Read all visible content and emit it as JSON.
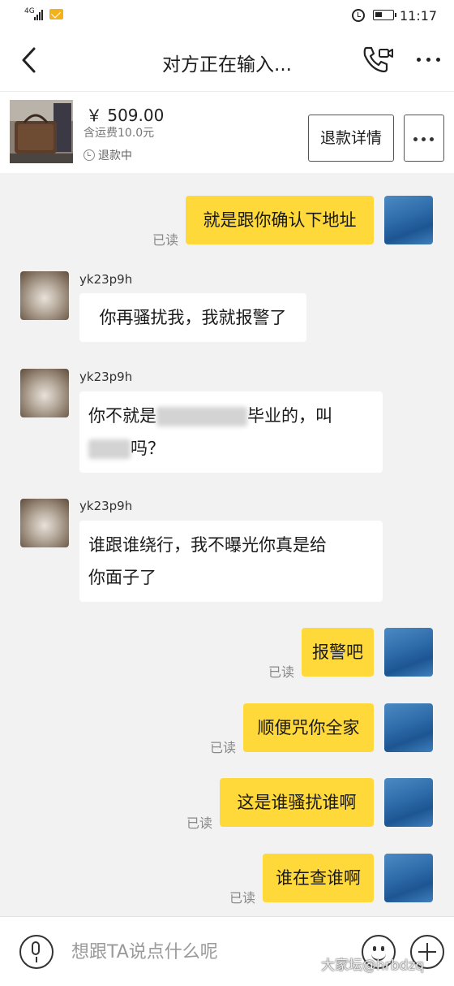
{
  "status_bar": {
    "network": "4G",
    "time": "11:17"
  },
  "header": {
    "title": "对方正在输入..."
  },
  "product": {
    "price": "￥ 509.00",
    "shipping": "含运费10.0元",
    "status": "退款中",
    "refund_button": "退款详情"
  },
  "messages": [
    {
      "side": "right",
      "text": "就是跟你确认下地址",
      "read": "已读"
    },
    {
      "side": "left",
      "user": "yk23p9h",
      "text": "你再骚扰我，我就报警了"
    },
    {
      "side": "left",
      "user": "yk23p9h",
      "line1_a": "你不就是",
      "line1_b": "毕业的，叫",
      "line2_b": "吗？"
    },
    {
      "side": "left",
      "user": "yk23p9h",
      "line1": "谁跟谁绕行，我不曝光你真是给",
      "line2": "你面子了"
    },
    {
      "side": "right",
      "text": "报警吧",
      "read": "已读"
    },
    {
      "side": "right",
      "text": "顺便咒你全家",
      "read": "已读"
    },
    {
      "side": "right",
      "text": "这是谁骚扰谁啊",
      "read": "已读"
    },
    {
      "side": "right",
      "text": "谁在查谁啊",
      "read": "已读"
    }
  ],
  "input_bar": {
    "placeholder": "想跟TA说点什么呢"
  },
  "watermark": "大家坛@hrbdzq",
  "icons": {
    "back": "chevron-left-icon",
    "call": "phone-video-icon",
    "more": "more-dots-icon",
    "status": "clock-icon",
    "mic": "microphone-icon",
    "emoji": "emoji-icon",
    "plus": "plus-icon"
  },
  "colors": {
    "bubble_self": "#ffd83a",
    "bubble_other": "#ffffff",
    "background": "#f2f2f2"
  }
}
